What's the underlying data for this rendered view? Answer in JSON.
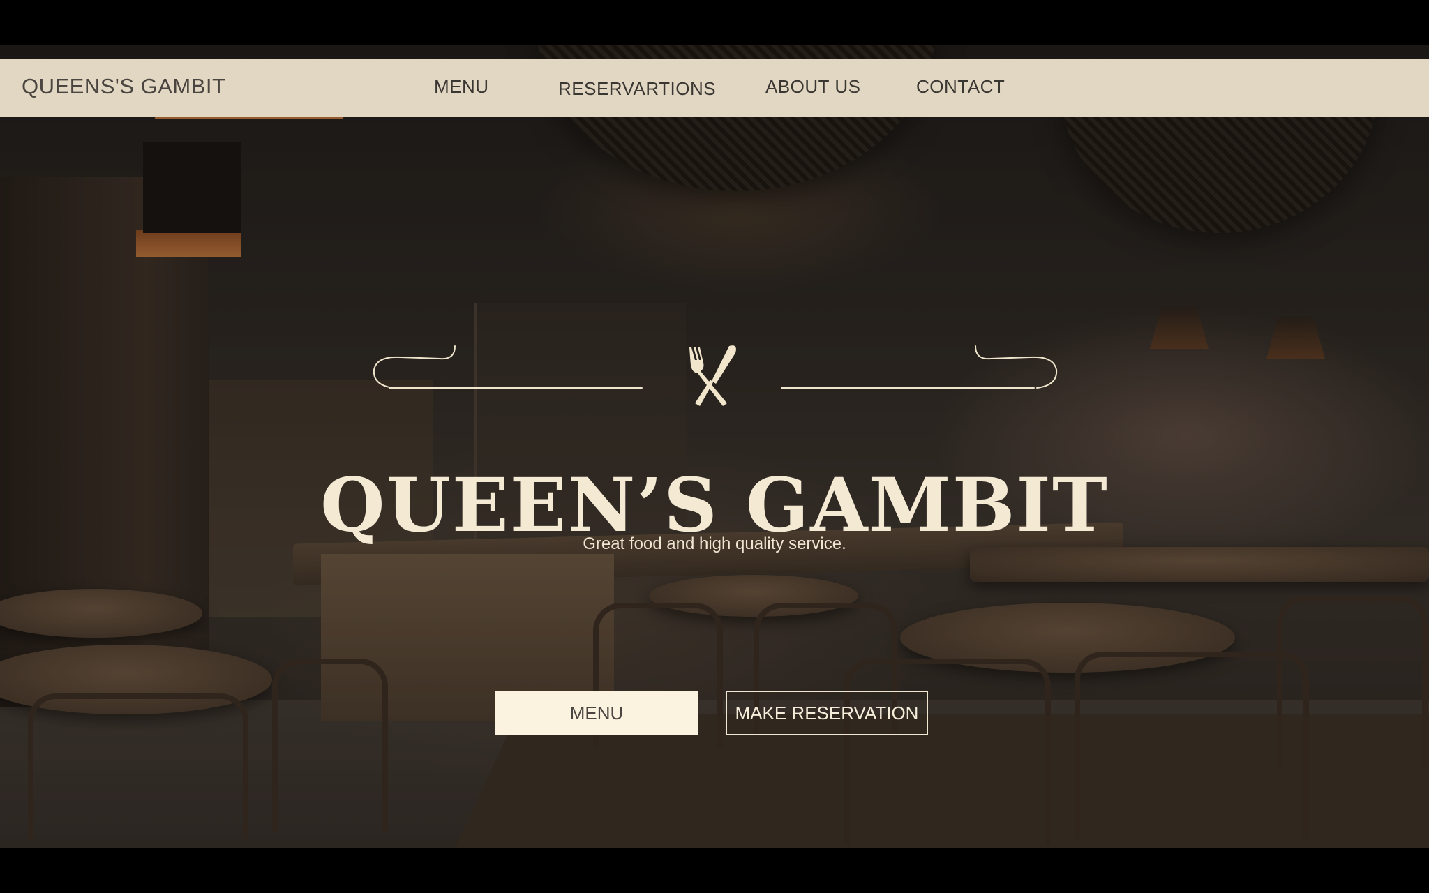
{
  "nav": {
    "brand": "QUEENS'S GAMBIT",
    "items": [
      {
        "label": "MENU"
      },
      {
        "label": "RESERVARTIONS"
      },
      {
        "label": "ABOUT US"
      },
      {
        "label": "CONTACT"
      }
    ]
  },
  "hero": {
    "emblem_icon": "fork-knife-icon",
    "title": "QUEEN’S GAMBIT",
    "tagline": "Great food and high quality service.",
    "buttons": {
      "menu_label": "MENU",
      "reservation_label": "MAKE RESERVATION"
    }
  },
  "colors": {
    "nav_background": "#e2d7c2",
    "accent_cream": "#fbf3df",
    "text_dark": "#3a3632"
  }
}
